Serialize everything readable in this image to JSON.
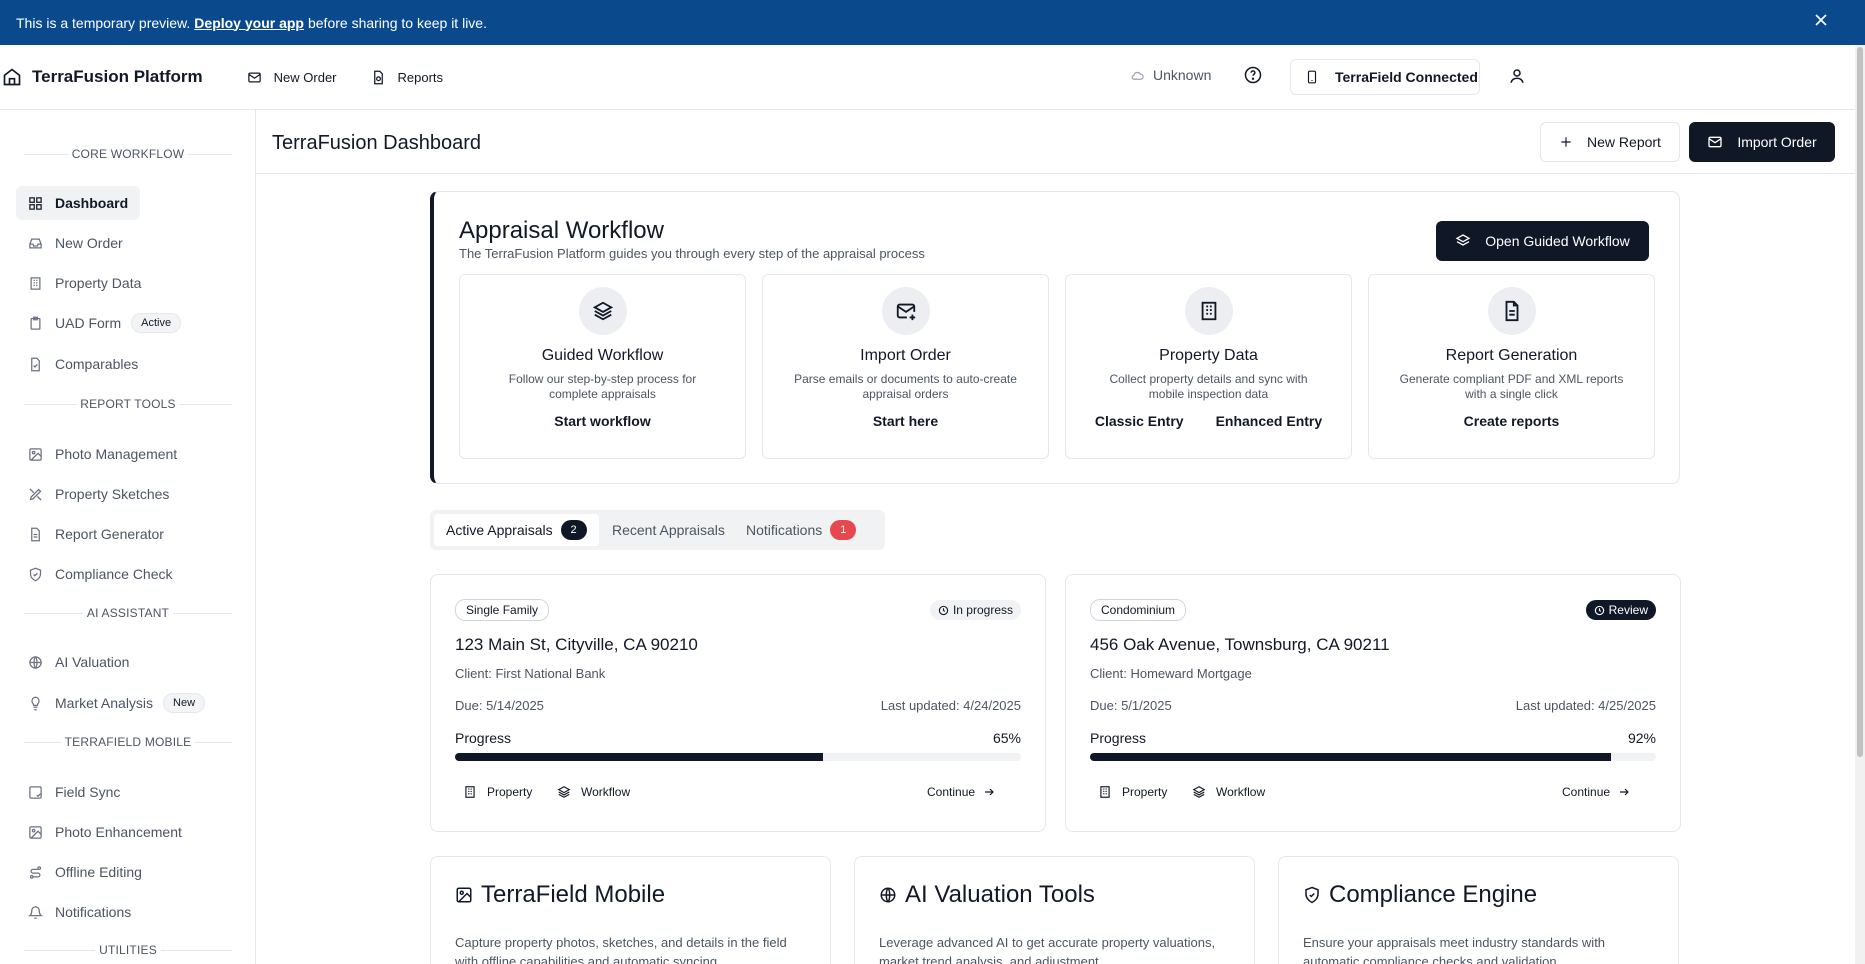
{
  "banner": {
    "text_before": "This is a temporary preview.",
    "link": "Deploy your app",
    "text_after": "before sharing to keep it live."
  },
  "topnav": {
    "brand": "TerraFusion Platform",
    "links": [
      "New Order",
      "Reports"
    ],
    "status": "Unknown",
    "connection": "TerraField Connected"
  },
  "sidebar": {
    "sections": [
      "CORE WORKFLOW",
      "REPORT TOOLS",
      "AI ASSISTANT",
      "TERRAFIELD MOBILE",
      "UTILITIES"
    ],
    "items": [
      {
        "label": "Dashboard"
      },
      {
        "label": "New Order"
      },
      {
        "label": "Property Data"
      },
      {
        "label": "UAD Form",
        "badge": "Active"
      },
      {
        "label": "Comparables"
      },
      {
        "label": "Photo Management"
      },
      {
        "label": "Property Sketches"
      },
      {
        "label": "Report Generator"
      },
      {
        "label": "Compliance Check"
      },
      {
        "label": "AI Valuation"
      },
      {
        "label": "Market Analysis",
        "badge": "New"
      },
      {
        "label": "Field Sync"
      },
      {
        "label": "Photo Enhancement"
      },
      {
        "label": "Offline Editing"
      },
      {
        "label": "Notifications"
      }
    ]
  },
  "header": {
    "title": "TerraFusion Dashboard",
    "new_report": "New Report",
    "import_order": "Import Order"
  },
  "workflow": {
    "title": "Appraisal Workflow",
    "subtitle": "The TerraFusion Platform guides you through every step of the appraisal process",
    "open_button": "Open Guided Workflow",
    "cards": [
      {
        "title": "Guided Workflow",
        "desc": "Follow our step-by-step process for complete appraisals",
        "actions": [
          "Start workflow"
        ]
      },
      {
        "title": "Import Order",
        "desc": "Parse emails or documents to auto-create appraisal orders",
        "actions": [
          "Start here"
        ]
      },
      {
        "title": "Property Data",
        "desc": "Collect property details and sync with mobile inspection data",
        "actions": [
          "Classic Entry",
          "Enhanced Entry"
        ]
      },
      {
        "title": "Report Generation",
        "desc": "Generate compliant PDF and XML reports with a single click",
        "actions": [
          "Create reports"
        ]
      }
    ]
  },
  "tabs": [
    {
      "label": "Active Appraisals",
      "count": "2"
    },
    {
      "label": "Recent Appraisals"
    },
    {
      "label": "Notifications",
      "count": "1"
    }
  ],
  "appraisals": [
    {
      "type": "Single Family",
      "status": "In progress",
      "address": "123 Main St, Cityville, CA 90210",
      "client": "Client: First National Bank",
      "due": "Due: 5/14/2025",
      "updated": "Last updated: 4/24/2025",
      "progress_label": "Progress",
      "progress": "65%",
      "progress_fraction": 0.65,
      "actions": [
        "Property",
        "Workflow",
        "Continue"
      ]
    },
    {
      "type": "Condominium",
      "status": "Review",
      "address": "456 Oak Avenue, Townsburg, CA 90211",
      "client": "Client: Homeward Mortgage",
      "due": "Due: 5/1/2025",
      "updated": "Last updated: 4/25/2025",
      "progress_label": "Progress",
      "progress": "92%",
      "progress_fraction": 0.92,
      "actions": [
        "Property",
        "Workflow",
        "Continue"
      ]
    }
  ],
  "features": [
    {
      "title": "TerraField Mobile",
      "desc": "Capture property photos, sketches, and details in the field with offline capabilities and automatic syncing."
    },
    {
      "title": "AI Valuation Tools",
      "desc": "Leverage advanced AI to get accurate property valuations, market trend analysis, and adjustment"
    },
    {
      "title": "Compliance Engine",
      "desc": "Ensure your appraisals meet industry standards with automatic compliance checks and validation."
    }
  ],
  "colors": {
    "banner": "#0a4a8c",
    "primary": "#101828",
    "badge_red": "#e5484d"
  }
}
